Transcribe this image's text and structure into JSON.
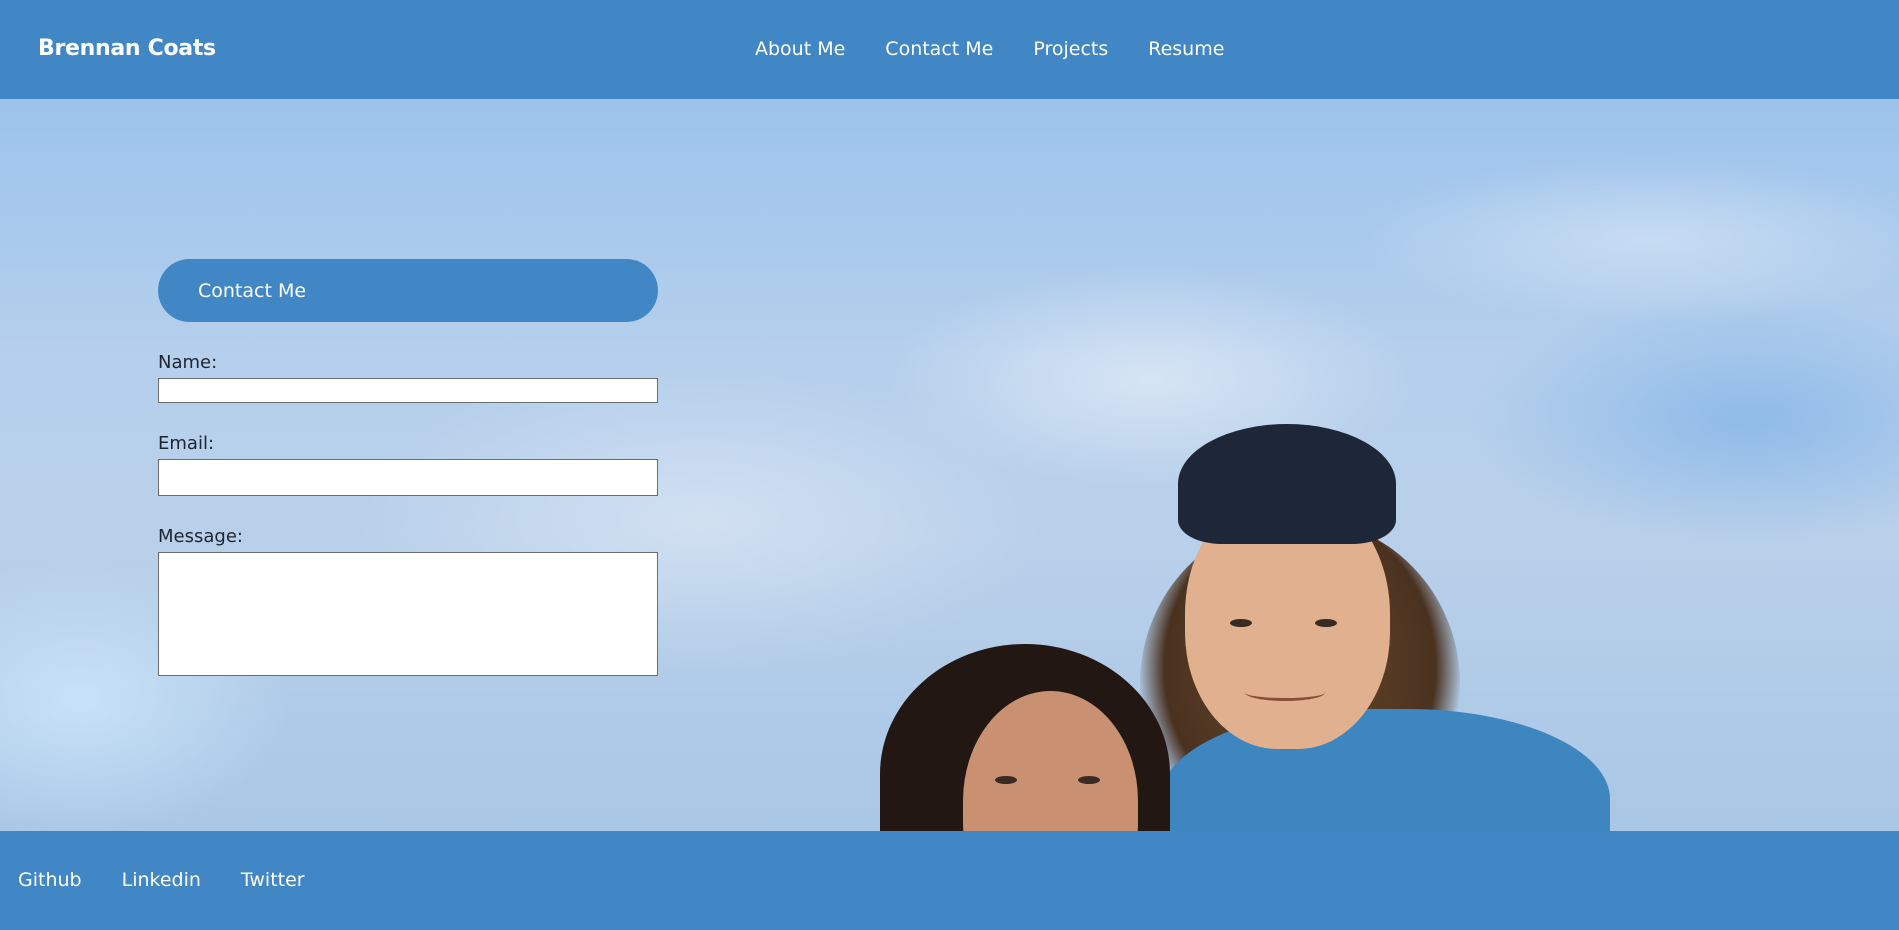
{
  "header": {
    "brand": "Brennan Coats",
    "nav": [
      "About Me",
      "Contact Me",
      "Projects",
      "Resume"
    ]
  },
  "contact": {
    "title": "Contact Me",
    "name_label": "Name:",
    "name_value": "",
    "email_label": "Email:",
    "email_value": "",
    "message_label": "Message:",
    "message_value": ""
  },
  "footer": {
    "links": [
      "Github",
      "Linkedin",
      "Twitter"
    ]
  },
  "colors": {
    "accent": "#4287c5",
    "text_light": "#ffffff",
    "label_text": "#1d2530"
  },
  "hero": {
    "image": "photo of two people smiling against a cloudy blue sky"
  }
}
